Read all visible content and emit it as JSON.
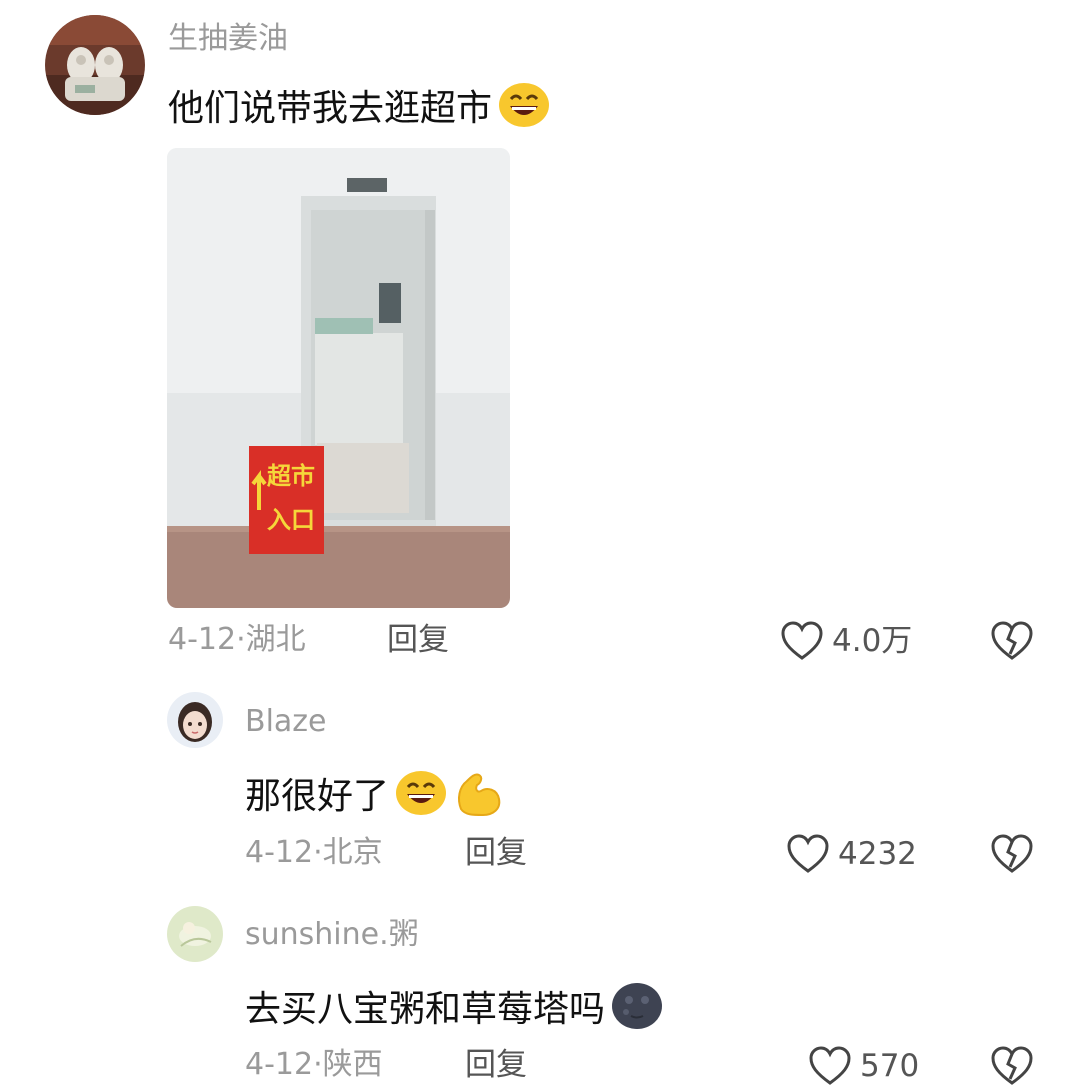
{
  "comments": [
    {
      "username": "生抽姜油",
      "text": "他们说带我去逛超市",
      "emoji": [
        "grinning-face-emoji"
      ],
      "image": {
        "sign_line1": "超市",
        "sign_line2": "入口"
      },
      "date": "4-12",
      "location": "湖北",
      "reply_label": "回复",
      "likes": "4.0万"
    },
    {
      "username": "Blaze",
      "text": "那很好了",
      "emoji": [
        "grinning-face-emoji",
        "flexed-biceps-emoji"
      ],
      "date": "4-12",
      "location": "北京",
      "reply_label": "回复",
      "likes": "4232"
    },
    {
      "username": "sunshine.粥",
      "text": "去买八宝粥和草莓塔吗",
      "emoji": [
        "new-moon-face-emoji"
      ],
      "date": "4-12",
      "location": "陕西",
      "reply_label": "回复",
      "likes": "570"
    }
  ],
  "meta_separator": "·",
  "icons": {
    "like": "heart-outline-icon",
    "dislike": "broken-heart-icon"
  },
  "colors": {
    "meta_text": "#9a9a9a",
    "content_text": "#111111",
    "sign_red": "#d92f27",
    "sign_yellow": "#f5d73a",
    "emoji_yellow": "#f8c72d"
  }
}
